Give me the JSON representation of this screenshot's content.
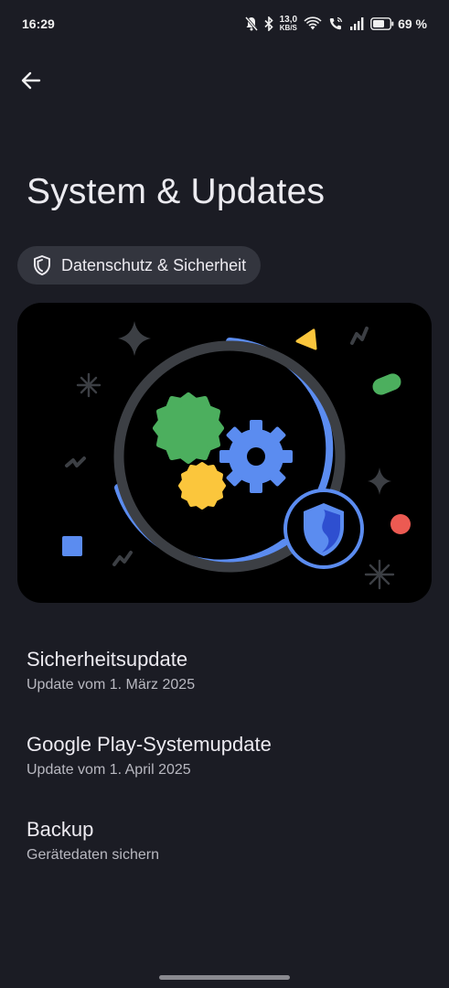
{
  "status_bar": {
    "time": "16:29",
    "net_speed_value": "13,0",
    "net_speed_unit": "KB/S",
    "battery_percent": "69 %",
    "icons": [
      "mute-icon",
      "bluetooth-icon",
      "wifi-icon",
      "wifi-call-icon",
      "signal-icon",
      "battery-icon"
    ]
  },
  "header": {
    "back_icon": "arrow-left-icon",
    "title": "System & Updates"
  },
  "chip": {
    "icon": "shield-icon",
    "label": "Datenschutz & Sicherheit"
  },
  "list": {
    "items": [
      {
        "title": "Sicherheitsupdate",
        "subtitle": "Update vom 1. März 2025"
      },
      {
        "title": "Google Play-Systemupdate",
        "subtitle": "Update vom 1. April 2025"
      },
      {
        "title": "Backup",
        "subtitle": "Gerätedaten sichern"
      }
    ]
  },
  "colors": {
    "background": "#1b1c24",
    "chip": "#33353e",
    "accent_blue": "#5b8cf0",
    "green": "#4caf5e",
    "yellow": "#fbc63c",
    "red": "#ec5a52"
  }
}
